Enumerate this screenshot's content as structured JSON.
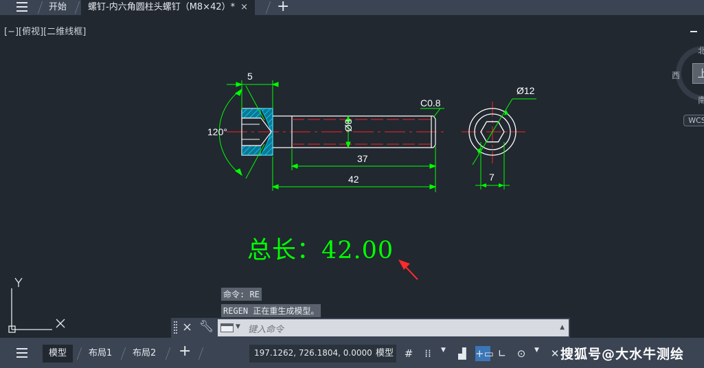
{
  "tabs": {
    "start": "开始",
    "document": "螺钉-内六角圆柱头螺钉（M8×42）*",
    "close_glyph": "×",
    "new_glyph": "+"
  },
  "viewport": {
    "view_label": "[−][俯视][二维线框]"
  },
  "viewcube": {
    "face": "上",
    "north": "北",
    "west": "西",
    "south": "南",
    "wcs": "WCS"
  },
  "ucs": {
    "y": "Y",
    "x": "X"
  },
  "drawing": {
    "dims": {
      "head_len": "5",
      "angle": "120°",
      "chamfer": "C0.8",
      "thread_dia": "Ø8",
      "thread_len": "37",
      "total_len": "42",
      "head_dia": "Ø12",
      "hex_size": "7"
    },
    "colors": {
      "outline": "#ffffff",
      "dimension": "#00ff00",
      "center": "#ff2020",
      "hatch": "#00c8ff",
      "arrow": "#ff2a2a"
    }
  },
  "annotation": {
    "total_length": "总长：42.00"
  },
  "command": {
    "history": [
      "命令: RE",
      "REGEN 正在重生成模型。"
    ],
    "placeholder": "键入命令"
  },
  "statusbar": {
    "model_tab": "模型",
    "layout1": "布局1",
    "layout2": "布局2",
    "coords": "197.1262, 726.1804, 0.0000",
    "mode": "模型",
    "watermark": "搜狐号@大水牛测绘"
  }
}
